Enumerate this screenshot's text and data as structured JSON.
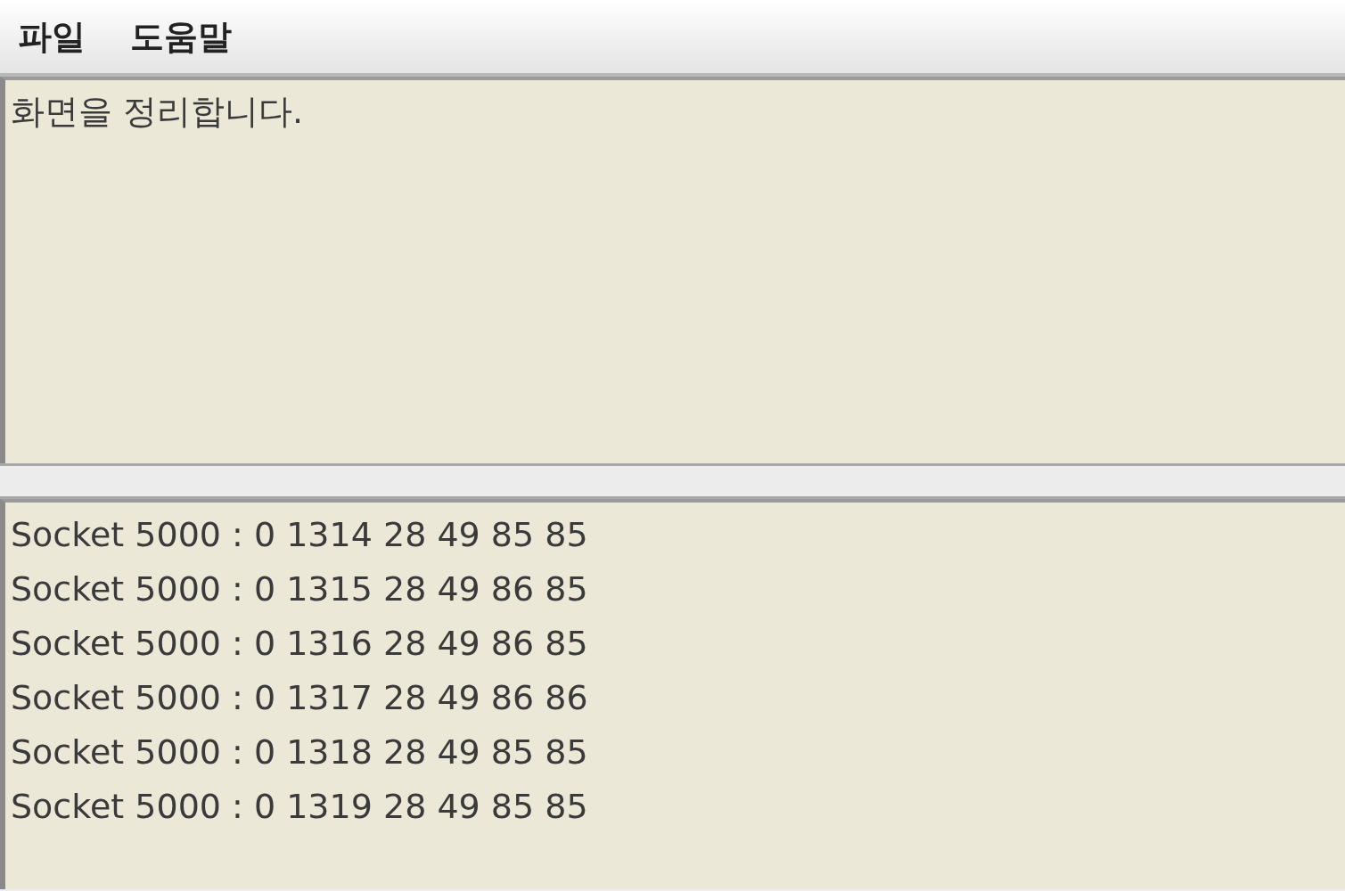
{
  "menu_bar": {
    "items": [
      "파일",
      "도움말"
    ]
  },
  "top_panel": {
    "lines": [
      "화면을 정리합니다."
    ]
  },
  "bottom_panel": {
    "lines": [
      "Socket 5000 : 0 1314 28 49 85 85",
      "Socket 5000 : 0 1315 28 49 86 85",
      "Socket 5000 : 0 1316 28 49 86 85",
      "Socket 5000 : 0 1317 28 49 86 86",
      "Socket 5000 : 0 1318 28 49 85 85",
      "Socket 5000 : 0 1319 28 49 85 85"
    ]
  }
}
